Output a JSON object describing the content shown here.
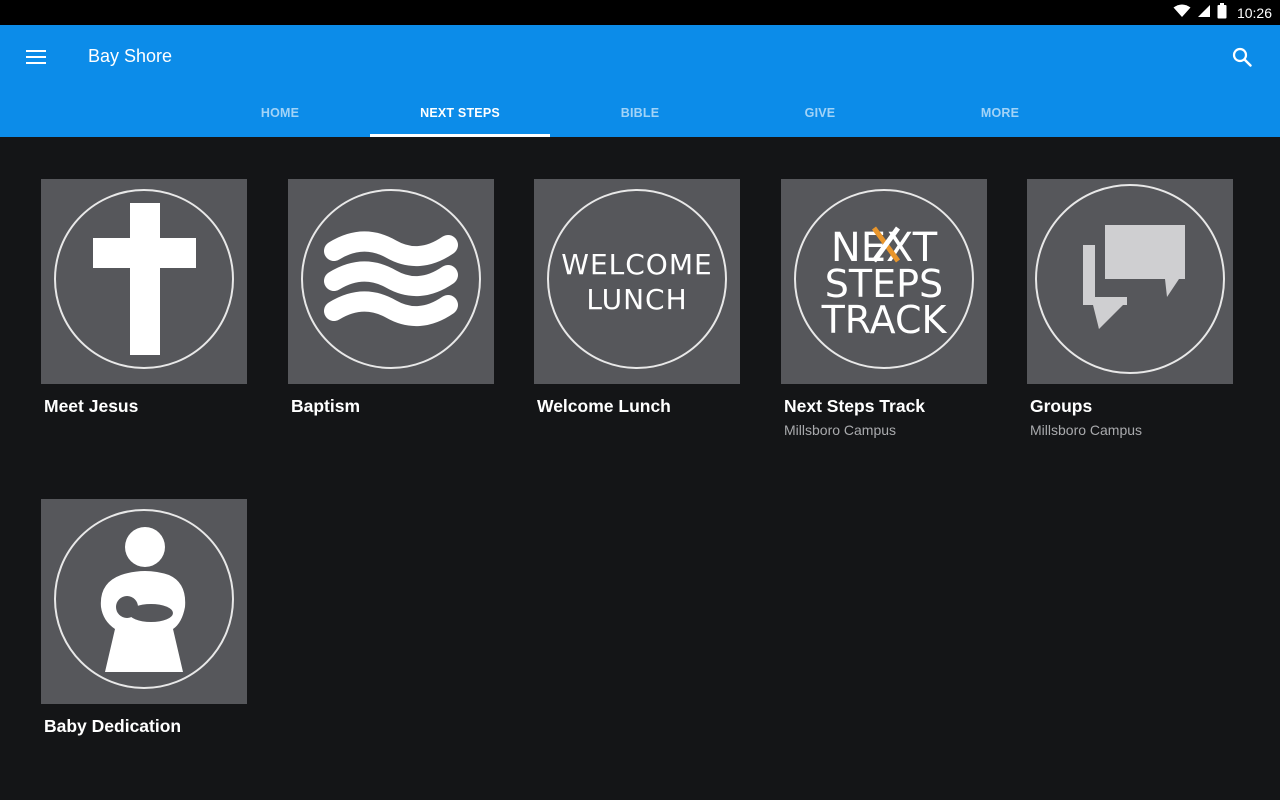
{
  "status_bar": {
    "time": "10:26",
    "icons": [
      "wifi-icon",
      "cell-signal-icon",
      "battery-icon"
    ]
  },
  "app_bar": {
    "title": "Bay Shore",
    "menu_icon": "hamburger-menu-icon",
    "search_icon": "search-icon",
    "color": "#0c8ce9"
  },
  "tabs": [
    {
      "label": "HOME",
      "active": false
    },
    {
      "label": "NEXT STEPS",
      "active": true
    },
    {
      "label": "BIBLE",
      "active": false
    },
    {
      "label": "GIVE",
      "active": false
    },
    {
      "label": "MORE",
      "active": false
    }
  ],
  "tiles": [
    {
      "title": "Meet Jesus",
      "subtitle": "",
      "icon": "cross-icon"
    },
    {
      "title": "Baptism",
      "subtitle": "",
      "icon": "waves-icon"
    },
    {
      "title": "Welcome Lunch",
      "subtitle": "",
      "icon": "welcome-lunch-icon",
      "icon_text": [
        "WELCOME",
        "LUNCH"
      ]
    },
    {
      "title": "Next Steps Track",
      "subtitle": "Millsboro Campus",
      "icon": "next-steps-track-icon",
      "icon_text": [
        "NEXT",
        "STEPS",
        "TRACK"
      ],
      "accent": "#e8952b"
    },
    {
      "title": "Groups",
      "subtitle": "Millsboro Campus",
      "icon": "chat-bubbles-icon"
    },
    {
      "title": "Baby Dedication",
      "subtitle": "",
      "icon": "parent-baby-icon"
    }
  ]
}
